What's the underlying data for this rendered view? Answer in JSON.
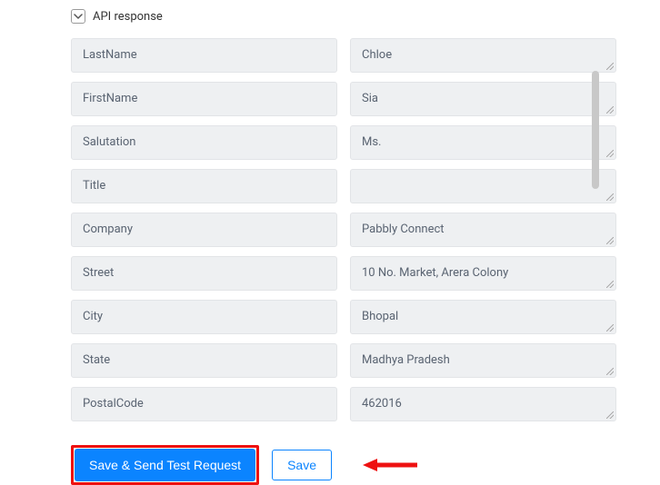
{
  "section": {
    "title": "API response"
  },
  "fields": [
    {
      "key": "LastName",
      "value": "Chloe"
    },
    {
      "key": "FirstName",
      "value": "Sia"
    },
    {
      "key": "Salutation",
      "value": "Ms."
    },
    {
      "key": "Title",
      "value": ""
    },
    {
      "key": "Company",
      "value": "Pabbly Connect"
    },
    {
      "key": "Street",
      "value": "10 No. Market, Arera Colony"
    },
    {
      "key": "City",
      "value": "Bhopal"
    },
    {
      "key": "State",
      "value": "Madhya Pradesh"
    },
    {
      "key": "PostalCode",
      "value": "462016"
    }
  ],
  "buttons": {
    "primary": "Save & Send Test Request",
    "secondary": "Save"
  }
}
